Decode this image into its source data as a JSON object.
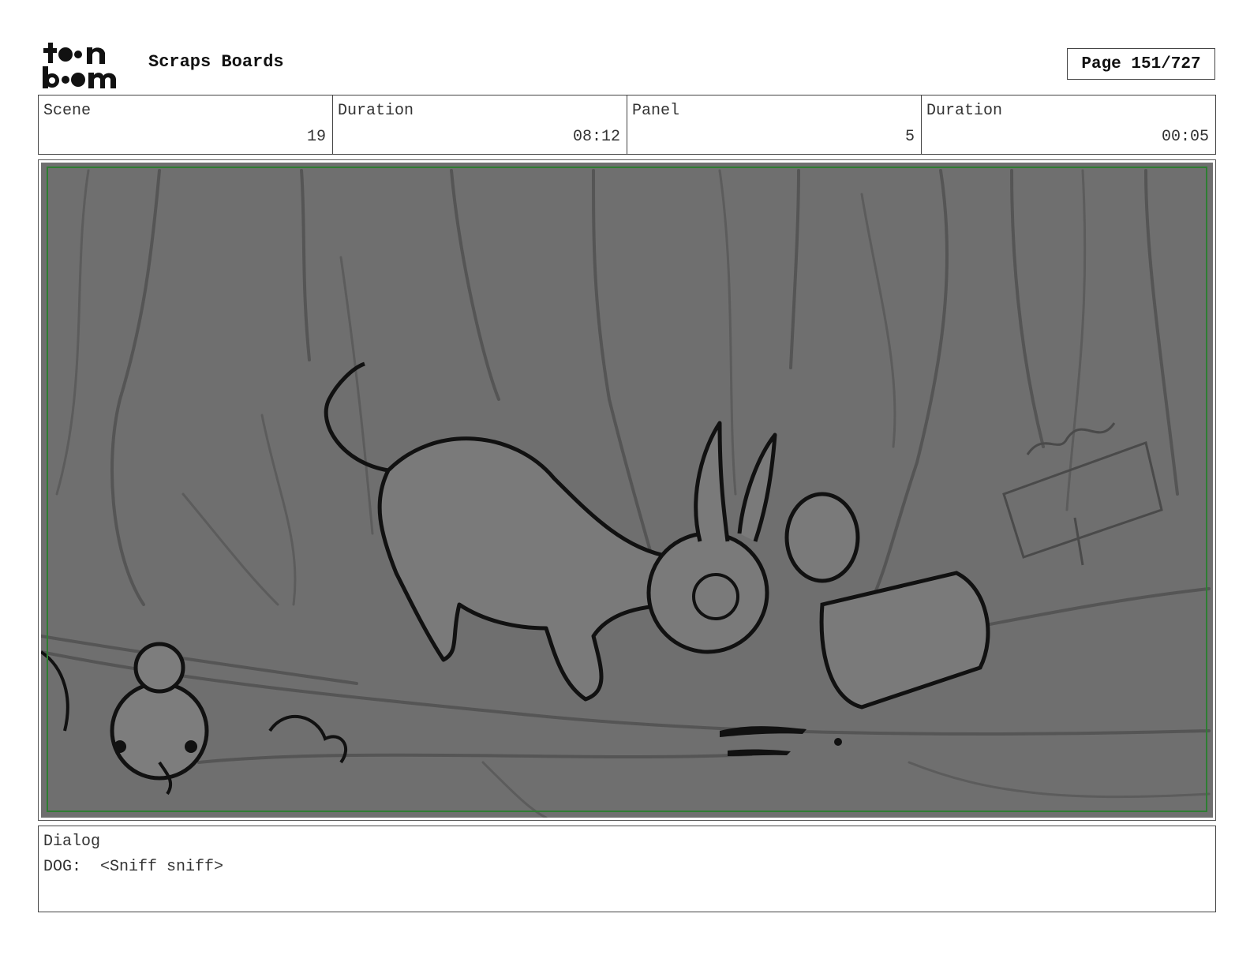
{
  "header": {
    "logo_alt": "toon boom",
    "title": "Scraps Boards",
    "page_label": "Page 151/727"
  },
  "info": [
    {
      "label": "Scene",
      "value": "19"
    },
    {
      "label": "Duration",
      "value": "08:12"
    },
    {
      "label": "Panel",
      "value": "5"
    },
    {
      "label": "Duration",
      "value": "00:05"
    }
  ],
  "panel": {
    "background_color": "#6f6f6f",
    "safe_frame_color": "#2e7d32"
  },
  "dialog": {
    "label": "Dialog",
    "text": "DOG:  <Sniff sniff>"
  }
}
